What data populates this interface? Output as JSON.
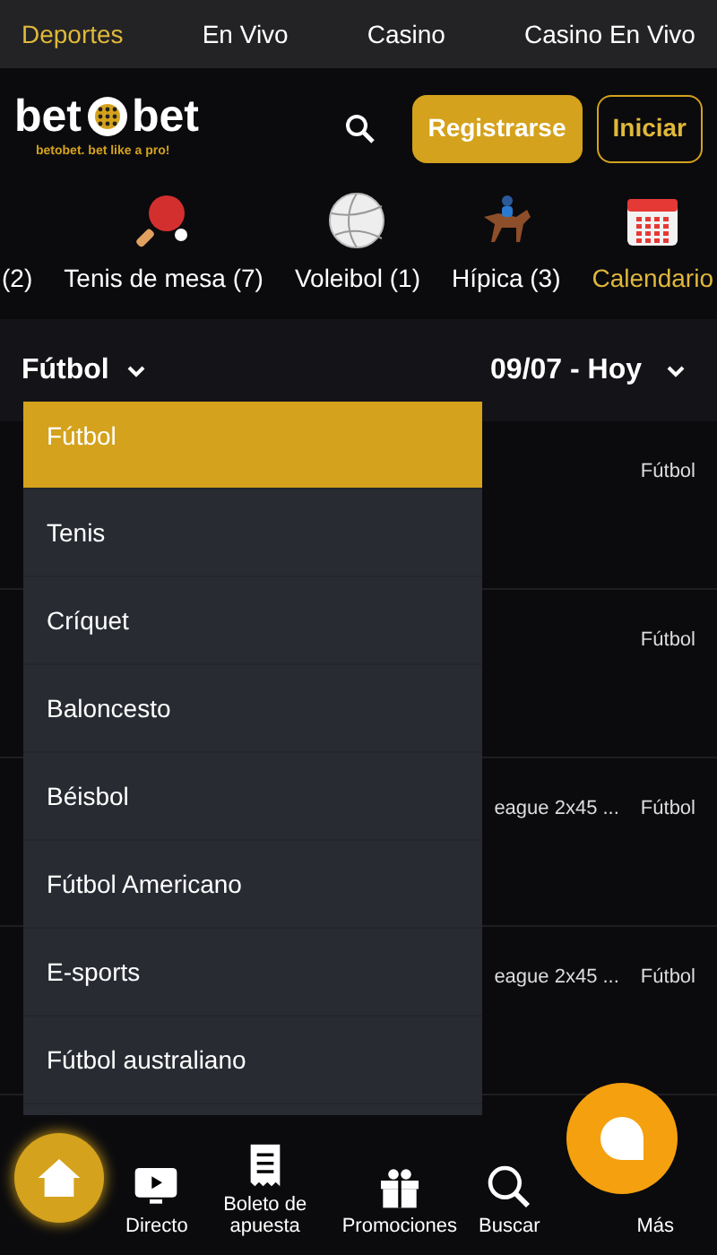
{
  "top_tabs": [
    {
      "label": "Deportes",
      "selected": true
    },
    {
      "label": "En Vivo",
      "selected": false
    },
    {
      "label": "Casino",
      "selected": false
    },
    {
      "label": "Casino En Vivo",
      "selected": false
    }
  ],
  "logo": {
    "left": "bet",
    "right": "bet",
    "tagline": "betobet. bet like a pro!"
  },
  "header_buttons": [
    {
      "label": "Registrarse",
      "kind": "primary"
    },
    {
      "label": "Iniciar",
      "kind": "outline"
    }
  ],
  "sports": [
    {
      "label": "(2)",
      "kind": "none",
      "selected": false
    },
    {
      "label": "Tenis de mesa (7)",
      "kind": "paddle",
      "selected": false
    },
    {
      "label": "Voleibol (1)",
      "kind": "ball",
      "selected": false
    },
    {
      "label": "Hípica (3)",
      "kind": "horse",
      "selected": false
    },
    {
      "label": "Calendario",
      "kind": "calendar",
      "selected": true
    }
  ],
  "filters": {
    "sport": "Fútbol",
    "date": "09/07 - Hoy"
  },
  "matches": [
    {
      "sport": "Fútbol"
    },
    {
      "sport": "Fútbol"
    },
    {
      "league": "eague 2x45 ...",
      "sport": "Fútbol"
    },
    {
      "league": "eague 2x45 ...",
      "sport": "Fútbol"
    }
  ],
  "dropdown": [
    {
      "label": "Fútbol",
      "selected": true
    },
    {
      "label": "Tenis",
      "selected": false
    },
    {
      "label": "Críquet",
      "selected": false
    },
    {
      "label": "Baloncesto",
      "selected": false
    },
    {
      "label": "Béisbol",
      "selected": false
    },
    {
      "label": "Fútbol Americano",
      "selected": false
    },
    {
      "label": "E-sports",
      "selected": false
    },
    {
      "label": "Fútbol australiano",
      "selected": false
    }
  ],
  "bottom_nav": [
    {
      "kind": "home",
      "selected": true
    },
    {
      "label": "Directo",
      "kind": "play",
      "selected": false
    },
    {
      "label": "Boleto de apuesta",
      "kind": "slip",
      "selected": false
    },
    {
      "label": "Promociones",
      "kind": "gift",
      "selected": false
    },
    {
      "label": "Buscar",
      "kind": "search",
      "selected": false
    },
    {
      "label": "Más",
      "kind": "more",
      "selected": false
    }
  ]
}
